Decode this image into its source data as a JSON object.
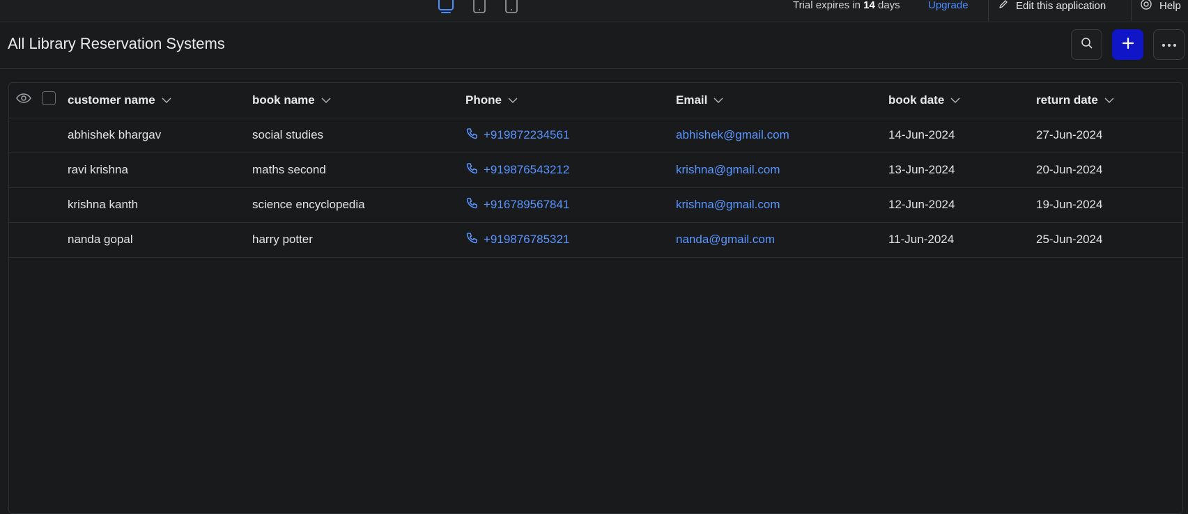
{
  "topbar": {
    "device_icons": [
      "desktop-icon",
      "tablet-icon",
      "mobile-icon"
    ],
    "trial_prefix": "Trial expires in ",
    "trial_days": "14",
    "trial_suffix": " days",
    "upgrade_label": "Upgrade",
    "edit_label": "Edit this application",
    "help_label": "Help"
  },
  "header": {
    "title": "All Library Reservation Systems"
  },
  "colors": {
    "accent": "#1016c7",
    "link": "#5b95ff",
    "active_device": "#4b8dff"
  },
  "table": {
    "columns": [
      "customer name",
      "book name",
      "Phone",
      "Email",
      "book date",
      "return date"
    ],
    "rows": [
      {
        "customer": "abhishek bhargav",
        "book": "social studies",
        "phone": "+919872234561",
        "email": "abhishek@gmail.com",
        "book_date": "14-Jun-2024",
        "return_date": "27-Jun-2024"
      },
      {
        "customer": "ravi krishna",
        "book": "maths second",
        "phone": "+919876543212",
        "email": "krishna@gmail.com",
        "book_date": "13-Jun-2024",
        "return_date": "20-Jun-2024"
      },
      {
        "customer": "krishna kanth",
        "book": "science encyclopedia",
        "phone": "+916789567841",
        "email": "krishna@gmail.com",
        "book_date": "12-Jun-2024",
        "return_date": "19-Jun-2024"
      },
      {
        "customer": "nanda gopal",
        "book": "harry potter",
        "phone": "+919876785321",
        "email": "nanda@gmail.com",
        "book_date": "11-Jun-2024",
        "return_date": "25-Jun-2024"
      }
    ]
  }
}
